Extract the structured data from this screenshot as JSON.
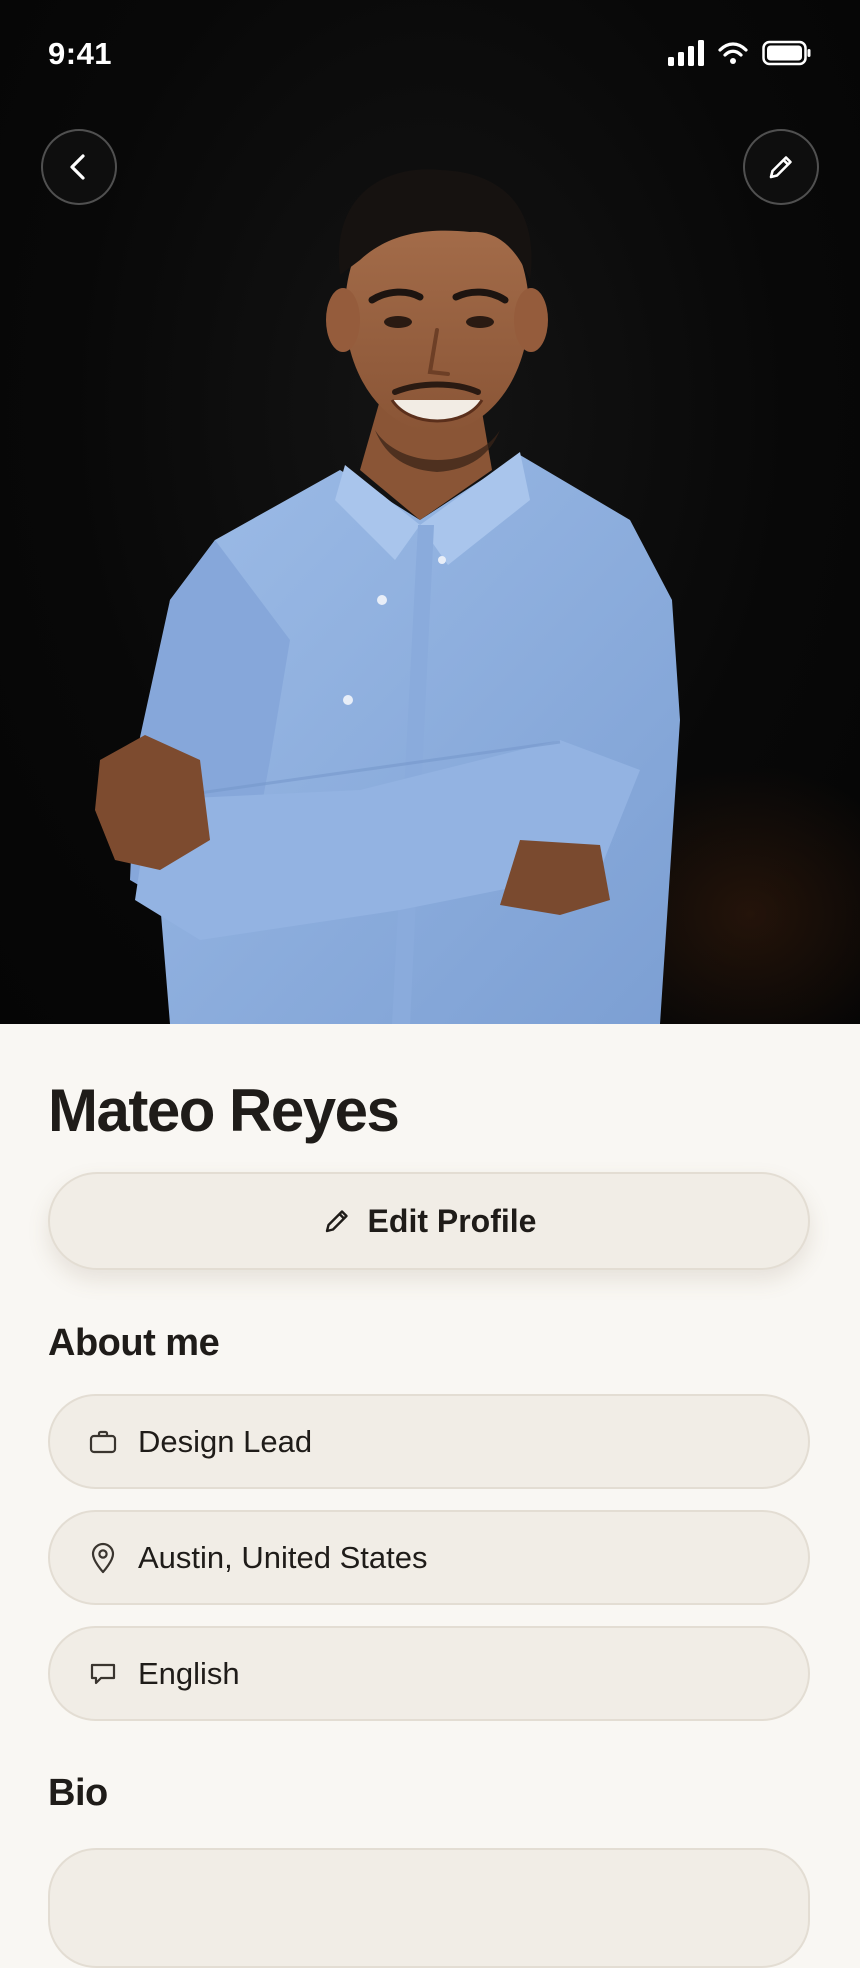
{
  "status_bar": {
    "time": "9:41"
  },
  "profile": {
    "name": "Mateo Reyes",
    "edit_profile_label": "Edit Profile"
  },
  "about": {
    "title": "About me",
    "items": [
      {
        "icon": "briefcase-icon",
        "text": "Design Lead"
      },
      {
        "icon": "location-pin-icon",
        "text": "Austin, United States"
      },
      {
        "icon": "speech-bubble-icon",
        "text": "English"
      }
    ]
  },
  "bio": {
    "title": "Bio"
  },
  "colors": {
    "background": "#f9f7f3",
    "pill": "#f1ede6",
    "pill_border": "#e3ddd3",
    "text": "#1f1c19",
    "shirt": "#8fb0df"
  }
}
